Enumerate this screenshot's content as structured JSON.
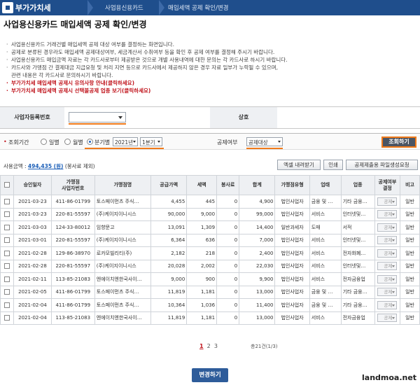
{
  "header": {
    "app_title": "부가가치세",
    "breadcrumb": [
      "사업용신용카드",
      "매입세액 공제 확인/변경"
    ]
  },
  "page_title": "사업용신용카드 매입세액 공제 확인/변경",
  "notices": [
    {
      "text": "사업용신용카드 거래건별 매입세액 공제 대상 여부를 결정하는 화면입니다.",
      "style": "normal"
    },
    {
      "text": "공제로 분류된 경우라도 매입세액 공제대상여부, 세금계산서 수취여부 등을 확인 후 공제 여부를 결정해 주시기 바랍니다.",
      "style": "normal"
    },
    {
      "text": "사업용신용카드 매입금액 자료는 각 카드사로부터 제공받은 것으로 개별 사용내역에 대한 문의는 각 카드사로 하시기 바랍니다.",
      "style": "normal"
    },
    {
      "text": "카드사와 가맹점 간 결제대금 지급요청 및 처리 지연 등으로 카드사에서 제공하지 않은 경우 자료 일부가 누락될 수 있으며,",
      "style": "normal"
    },
    {
      "text": "관련 내용은 각 카드사로 문의하시기 바랍니다.",
      "style": "sub"
    },
    {
      "text": "부가가치세 매입세액 공제시 유의사항 안내(클릭하세요)",
      "style": "red"
    },
    {
      "text": "부가가치세 매입세액 공제시 선택불공제 업종 보기(클릭하세요)",
      "style": "red"
    }
  ],
  "business": {
    "reg_label": "사업자등록번호",
    "reg_value": "",
    "name_label": "상호"
  },
  "filter": {
    "period_label": "조회기간",
    "options": [
      "일별",
      "월별",
      "분기별"
    ],
    "selected_option": "분기별",
    "year": "2021년",
    "quarter": "1분기",
    "deduct_label": "공제여부",
    "deduct_value": "공제대상",
    "query_button": "조회하기"
  },
  "usage": {
    "prefix": "사용금액 :",
    "amount": "494,435 (원)",
    "suffix": "(봉사료 제외)"
  },
  "actions": {
    "excel": "엑셀 내려받기",
    "print": "인쇄",
    "file": "공제제출용 파일생성요청"
  },
  "table": {
    "headers": [
      "",
      "승인일자",
      "가맹점\n사업자번호",
      "가맹점명",
      "공급가액",
      "세액",
      "봉사료",
      "합계",
      "가맹점유형",
      "업태",
      "업종",
      "공제여부\n결정",
      "비고"
    ],
    "deduct_option": "공제",
    "rows": [
      [
        "2021-03-23",
        "411-86-01799",
        "토스페이먼츠 주식…",
        "4,455",
        "445",
        "0",
        "4,900",
        "법인사업자",
        "금융 및 …",
        "기타 금융…",
        "일반"
      ],
      [
        "2021-03-23",
        "220-81-55597",
        "(주)케이지이니시스",
        "90,000",
        "9,000",
        "0",
        "99,000",
        "법인사업자",
        "서비스",
        "인터넷및…",
        "일반"
      ],
      [
        "2021-03-03",
        "124-33-80012",
        "임향문고",
        "13,091",
        "1,309",
        "0",
        "14,400",
        "일반과세자",
        "도매",
        "서적",
        "일반"
      ],
      [
        "2021-03-01",
        "220-81-55597",
        "(주)케이지이니시스",
        "6,364",
        "636",
        "0",
        "7,000",
        "법인사업자",
        "서비스",
        "인터넷및…",
        "일반"
      ],
      [
        "2021-02-28",
        "129-86-38970",
        "로카모빌리티(주)",
        "2,182",
        "218",
        "0",
        "2,400",
        "법인사업자",
        "서비스",
        "전자화폐…",
        "일반"
      ],
      [
        "2021-02-28",
        "220-81-55597",
        "(주)케이지이니시스",
        "20,028",
        "2,002",
        "0",
        "22,030",
        "법인사업자",
        "서비스",
        "인터넷및…",
        "일반"
      ],
      [
        "2021-02-11",
        "113-85-21083",
        "엔에이치엔한국사이…",
        "9,000",
        "900",
        "0",
        "9,900",
        "법인사업자",
        "서비스",
        "전자금융업",
        "일반"
      ],
      [
        "2021-02-05",
        "411-86-01799",
        "토스페이먼츠 주식…",
        "11,819",
        "1,181",
        "0",
        "13,000",
        "법인사업자",
        "금융 및 …",
        "기타 금융…",
        "일반"
      ],
      [
        "2021-02-04",
        "411-86-01799",
        "토스페이먼츠 주식…",
        "10,364",
        "1,036",
        "0",
        "11,400",
        "법인사업자",
        "금융 및 …",
        "기타 금융…",
        "일반"
      ],
      [
        "2021-02-04",
        "113-85-21083",
        "엔에이치엔한국사이…",
        "11,819",
        "1,181",
        "0",
        "13,000",
        "법인사업자",
        "서비스",
        "전자금융업",
        "일반"
      ]
    ]
  },
  "pagination": {
    "pages": [
      "1",
      "2",
      "3"
    ],
    "current": "1",
    "total": "총21건(1/3)"
  },
  "change_button": "변경하기",
  "watermark": "landmoa.net"
}
